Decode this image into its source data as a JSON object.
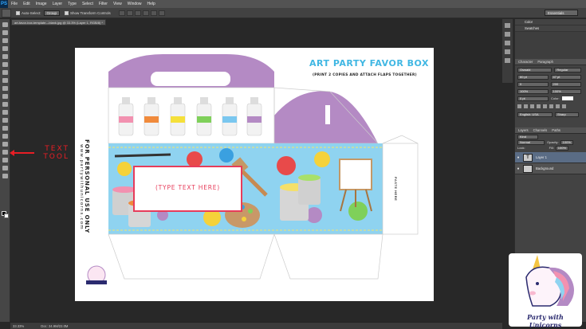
{
  "menu": [
    "PS",
    "File",
    "Edit",
    "Image",
    "Layer",
    "Type",
    "Select",
    "Filter",
    "View",
    "Window",
    "Help"
  ],
  "options": {
    "auto_select_label": "Auto-Select:",
    "auto_select_value": "Group",
    "transform_label": "Show Transform Controls",
    "workspace": "Essentials"
  },
  "document": {
    "tab": "art-favor-box-template---blank.jpg @ 33.3% (Layer 1, RGB/8) *",
    "zoom": "33.33%",
    "doc_size": "Doc: 24.9M/22.0M"
  },
  "annotation": {
    "text": "TEXT TOOL"
  },
  "canvas": {
    "title": "ART PARTY FAVOR BOX",
    "subtitle": "(PRINT 2 COPIES AND ATTACH FLAPS TOGETHER)",
    "side_text": "FOR PERSONAL USE ONLY",
    "side_url": "www.partywithunicorns.com",
    "text_field": "(TYPE TEXT HERE)",
    "flap_label": "PASTE HERE"
  },
  "panels": {
    "color_tabs": [
      "Color",
      "Swatches"
    ],
    "character_tabs": [
      "Character",
      "Paragraph"
    ],
    "font_family": "Oswald",
    "font_style": "Regular",
    "font_size": "60 pt",
    "leading": "47 pt",
    "kerning": "0",
    "tracking": "200",
    "vscale": "100%",
    "hscale": "100%",
    "baseline": "0 pt",
    "color_label": "Color:",
    "language": "English: USA",
    "aa": "Sharp",
    "layers_tabs": [
      "Layers",
      "Channels",
      "Paths"
    ],
    "kind": "Kind",
    "blend": "Normal",
    "opacity_label": "Opacity:",
    "opacity": "100%",
    "lock_label": "Lock:",
    "fill_label": "Fill:",
    "fill": "100%",
    "layers": [
      "Layer 1",
      "Background"
    ]
  },
  "brand": {
    "text": "Party with Unicorns"
  }
}
